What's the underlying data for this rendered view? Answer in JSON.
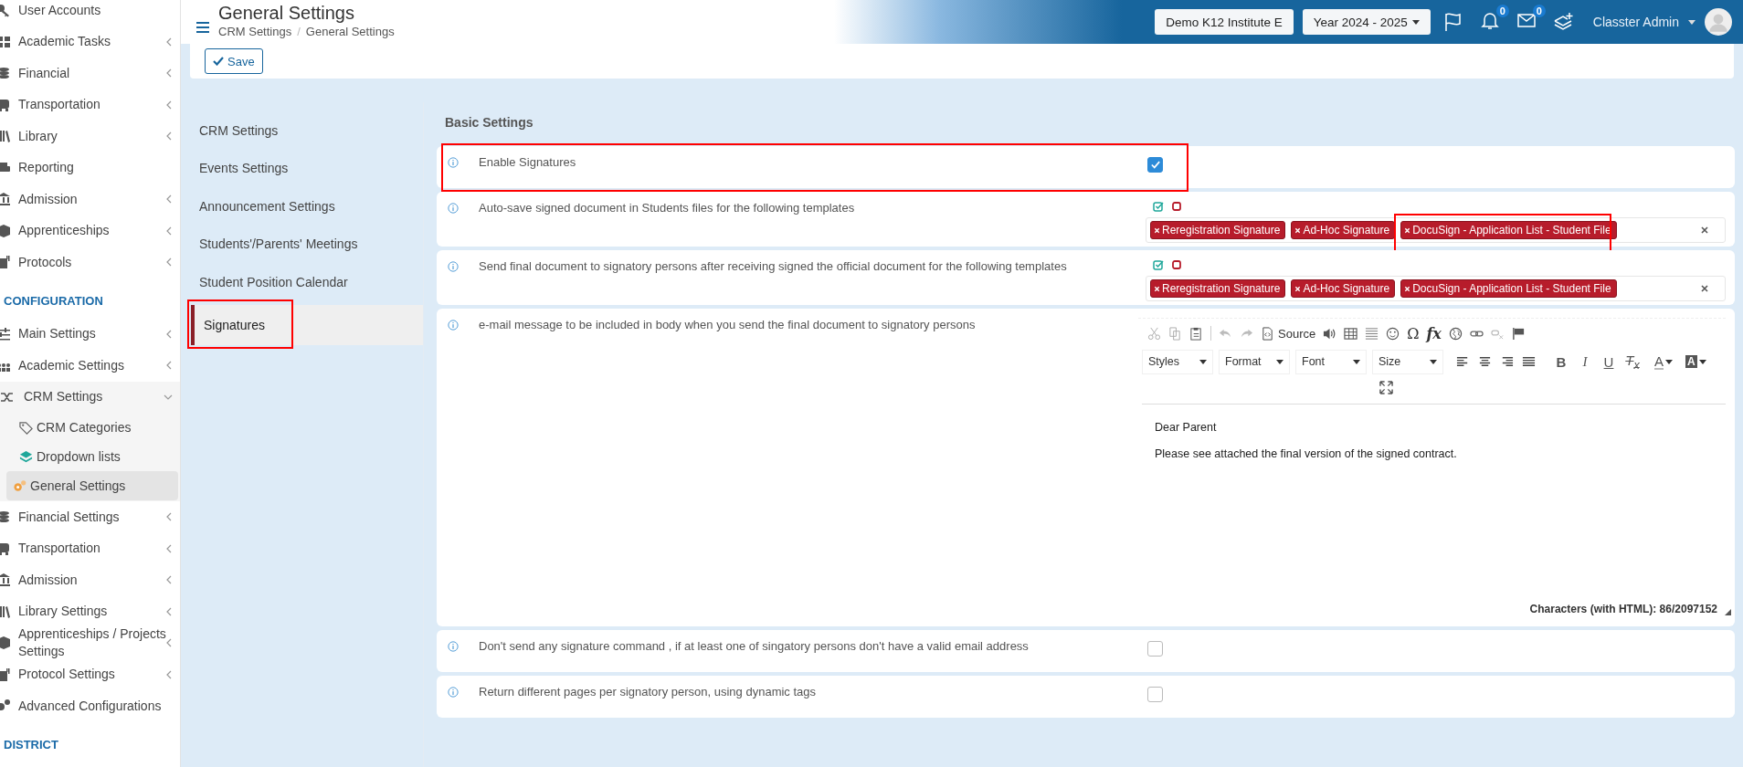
{
  "header": {
    "title": "General Settings",
    "breadcrumb": [
      "CRM Settings",
      "General Settings"
    ],
    "breadcrumb_separator": "/",
    "institute": "Demo K12 Institute E",
    "year": "Year 2024 - 2025",
    "notifications": "0",
    "messages": "0",
    "user": "Classter Admin"
  },
  "sidebar": {
    "items": [
      {
        "kind": "item",
        "label": "User Accounts",
        "has_submenu": false
      },
      {
        "kind": "item",
        "label": "Academic Tasks",
        "has_submenu": true
      },
      {
        "kind": "item",
        "label": "Financial",
        "has_submenu": true
      },
      {
        "kind": "item",
        "label": "Transportation",
        "has_submenu": true
      },
      {
        "kind": "item",
        "label": "Library",
        "has_submenu": true
      },
      {
        "kind": "item",
        "label": "Reporting",
        "has_submenu": false
      },
      {
        "kind": "item",
        "label": "Admission",
        "has_submenu": true
      },
      {
        "kind": "item",
        "label": "Apprenticeships",
        "has_submenu": true
      },
      {
        "kind": "item",
        "label": "Protocols",
        "has_submenu": true
      },
      {
        "kind": "section",
        "label": "CONFIGURATION"
      },
      {
        "kind": "item",
        "label": "Main Settings",
        "has_submenu": true
      },
      {
        "kind": "item",
        "label": "Academic Settings",
        "has_submenu": true
      },
      {
        "kind": "group",
        "label": "CRM Settings",
        "expanded": true,
        "children": [
          {
            "label": "CRM Categories",
            "selected": false
          },
          {
            "label": "Dropdown lists",
            "selected": false
          },
          {
            "label": "General Settings",
            "selected": true
          }
        ]
      },
      {
        "kind": "item",
        "label": "Financial Settings",
        "has_submenu": true
      },
      {
        "kind": "item",
        "label": "Transportation",
        "has_submenu": true
      },
      {
        "kind": "item",
        "label": "Admission",
        "has_submenu": true
      },
      {
        "kind": "item",
        "label": "Library Settings",
        "has_submenu": true
      },
      {
        "kind": "item",
        "label": "Apprenticeships / Projects Settings",
        "has_submenu": true
      },
      {
        "kind": "item",
        "label": "Protocol Settings",
        "has_submenu": true
      },
      {
        "kind": "item",
        "label": "Advanced Configurations",
        "has_submenu": false
      },
      {
        "kind": "section",
        "label": "DISTRICT"
      }
    ]
  },
  "toolbar": {
    "save": "Save"
  },
  "settings_menu": {
    "items": [
      {
        "label": "CRM Settings",
        "selected": false
      },
      {
        "label": "Events Settings",
        "selected": false
      },
      {
        "label": "Announcement Settings",
        "selected": false
      },
      {
        "label": "Students'/Parents' Meetings",
        "selected": false
      },
      {
        "label": "Student Position Calendar",
        "selected": false
      },
      {
        "label": "Signatures",
        "selected": true
      }
    ]
  },
  "basic_settings": {
    "title": "Basic Settings",
    "rows": [
      {
        "kind": "checkbox",
        "label": "Enable Signatures",
        "checked": true
      },
      {
        "kind": "tags",
        "label": "Auto-save signed document in Students files for the following templates",
        "tags": [
          "Reregistration Signature",
          "Ad-Hoc Signature",
          "DocuSign - Application List - Student File"
        ]
      },
      {
        "kind": "tags",
        "label": "Send final document to signatory persons after receiving signed the official document for the following templates",
        "tags": [
          "Reregistration Signature",
          "Ad-Hoc Signature",
          "DocuSign - Application List - Student File"
        ]
      },
      {
        "kind": "editor",
        "label": "e-mail message to be included in body when you send the final document to signatory persons",
        "source": "Source",
        "symbols": [
          "Ω",
          "fx"
        ],
        "dropdowns": [
          "Styles",
          "Format",
          "Font",
          "Size"
        ],
        "format_buttons": [
          "B",
          "I",
          "U",
          "T$_{x}$"
        ],
        "color_buttons": [
          "A",
          "A"
        ],
        "lines": [
          "Dear Parent",
          "Please see attached the final version of the signed contract."
        ],
        "counter": "Characters (with HTML): 86/2097152"
      },
      {
        "kind": "checkbox",
        "label": "Don't send any signature command , if at least one of singatory persons don't have a valid email address",
        "checked": false
      },
      {
        "kind": "checkbox",
        "label": "Return different pages per signatory person, using dynamic tags",
        "checked": false
      }
    ]
  }
}
